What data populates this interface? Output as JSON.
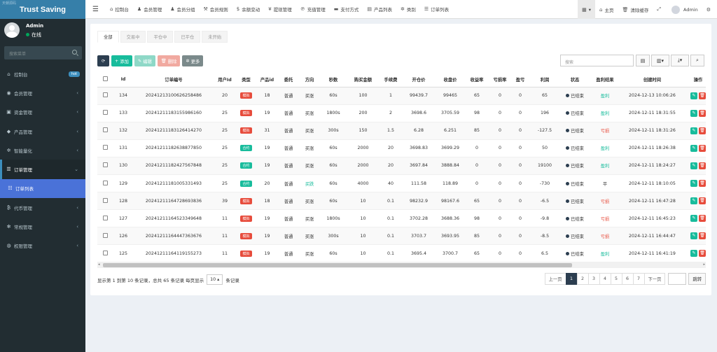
{
  "app": {
    "title": "Trust Saving",
    "watermark": "天朝源码"
  },
  "user": {
    "name": "Admin",
    "status": "在线"
  },
  "sidebar": {
    "search_placeholder": "搜索菜单",
    "items": [
      {
        "icon": "dashboard-icon",
        "glyph": "⌂",
        "label": "控制台",
        "badge": "hot"
      },
      {
        "icon": "user-icon",
        "glyph": "◉",
        "label": "会员管理",
        "arrow": "‹"
      },
      {
        "icon": "money-icon",
        "glyph": "▣",
        "label": "资金管理",
        "arrow": "‹"
      },
      {
        "icon": "product-icon",
        "glyph": "◆",
        "label": "产品管理",
        "arrow": "‹"
      },
      {
        "icon": "gear-icon",
        "glyph": "✲",
        "label": "智能量化",
        "arrow": "‹"
      },
      {
        "icon": "list-icon",
        "glyph": "☰",
        "label": "订单管理",
        "arrow": "⌄"
      },
      {
        "icon": "list-icon",
        "glyph": "☷",
        "label": "订单列表"
      },
      {
        "icon": "bitcoin-icon",
        "glyph": "₿",
        "label": "代币管理",
        "arrow": "‹"
      },
      {
        "icon": "cogs-icon",
        "glyph": "✻",
        "label": "常规管理",
        "arrow": "‹"
      },
      {
        "icon": "users-icon",
        "glyph": "◍",
        "label": "权限管理",
        "arrow": "‹"
      }
    ]
  },
  "topnav": {
    "items": [
      {
        "icon": "dashboard-icon",
        "glyph": "⌂",
        "label": "控制台"
      },
      {
        "icon": "user-icon",
        "glyph": "♟",
        "label": "会员管理"
      },
      {
        "icon": "users-icon",
        "glyph": "♟",
        "label": "会员分组"
      },
      {
        "icon": "gavel-icon",
        "glyph": "⚒",
        "label": "会员规则"
      },
      {
        "icon": "dollar-icon",
        "glyph": "$",
        "label": "余额变动"
      },
      {
        "icon": "yen-icon",
        "glyph": "¥",
        "label": "提现管理"
      },
      {
        "icon": "paypal-icon",
        "glyph": "℗",
        "label": "充值管理"
      },
      {
        "icon": "card-icon",
        "glyph": "▬",
        "label": "支付方式"
      },
      {
        "icon": "folder-icon",
        "glyph": "▤",
        "label": "产品列表"
      },
      {
        "icon": "gear-icon",
        "glyph": "✲",
        "label": "类别"
      },
      {
        "icon": "list-icon",
        "glyph": "☰",
        "label": "订单列表"
      }
    ],
    "right": {
      "home": "主页",
      "clear_cache": "清除缓存",
      "admin": "Admin"
    }
  },
  "tabs": [
    "全部",
    "交易中",
    "平仓中",
    "已平仓",
    "未开始"
  ],
  "toolbar": {
    "add": "添加",
    "edit": "编辑",
    "delete": "删除",
    "more": "更多"
  },
  "search": {
    "placeholder": "搜索"
  },
  "table": {
    "columns": [
      "Id",
      "订单编号",
      "用户Id",
      "类型",
      "产品id",
      "委托",
      "方向",
      "秒数",
      "购买金额",
      "手续费",
      "开仓价",
      "收盘价",
      "收益率",
      "亏损率",
      "盈亏",
      "利润",
      "状态",
      "盈利结果",
      "创建时间",
      "操作"
    ],
    "rows": [
      {
        "id": "134",
        "order_no": "20241213100626258486",
        "user_id": "20",
        "type": "模拟",
        "type_color": "red",
        "product_id": "18",
        "entrust": "普通",
        "direction": "买涨",
        "seconds": "60s",
        "amount": "100",
        "fee": "1",
        "open": "99439.7",
        "close": "99465",
        "rate": "65",
        "loss_rate": "0",
        "pnl": "0",
        "profit": "65",
        "status": "已结束",
        "result": "盈利",
        "result_color": "#18bc9c",
        "created": "2024-12-13 10:06:26"
      },
      {
        "id": "133",
        "order_no": "20241211183155986160",
        "user_id": "25",
        "type": "模拟",
        "type_color": "red",
        "product_id": "19",
        "entrust": "普通",
        "direction": "买涨",
        "seconds": "1800s",
        "amount": "200",
        "fee": "2",
        "open": "3698.6",
        "close": "3705.59",
        "rate": "98",
        "loss_rate": "0",
        "pnl": "0",
        "profit": "196",
        "status": "已结束",
        "result": "盈利",
        "result_color": "#18bc9c",
        "created": "2024-12-11 18:31:55"
      },
      {
        "id": "132",
        "order_no": "20241211183126414270",
        "user_id": "25",
        "type": "模拟",
        "type_color": "red",
        "product_id": "31",
        "entrust": "普通",
        "direction": "买涨",
        "seconds": "300s",
        "amount": "150",
        "fee": "1.5",
        "open": "6.28",
        "close": "6.251",
        "rate": "85",
        "loss_rate": "0",
        "pnl": "0",
        "profit": "-127.5",
        "status": "已结束",
        "result": "亏损",
        "result_color": "#e74c3c",
        "created": "2024-12-11 18:31:26"
      },
      {
        "id": "131",
        "order_no": "20241211182638877850",
        "user_id": "25",
        "type": "合约",
        "type_color": "grn",
        "product_id": "19",
        "entrust": "普通",
        "direction": "买涨",
        "seconds": "60s",
        "amount": "2000",
        "fee": "20",
        "open": "3698.83",
        "close": "3699.29",
        "rate": "0",
        "loss_rate": "0",
        "pnl": "0",
        "profit": "50",
        "status": "已结束",
        "result": "盈利",
        "result_color": "#18bc9c",
        "created": "2024-12-11 18:26:38"
      },
      {
        "id": "130",
        "order_no": "20241211182427567848",
        "user_id": "25",
        "type": "合约",
        "type_color": "grn",
        "product_id": "19",
        "entrust": "普通",
        "direction": "买涨",
        "seconds": "60s",
        "amount": "2000",
        "fee": "20",
        "open": "3697.84",
        "close": "3888.84",
        "rate": "0",
        "loss_rate": "0",
        "pnl": "0",
        "profit": "19100",
        "status": "已结束",
        "result": "盈利",
        "result_color": "#18bc9c",
        "created": "2024-12-11 18:24:27"
      },
      {
        "id": "129",
        "order_no": "20241211181005331493",
        "user_id": "25",
        "type": "合约",
        "type_color": "grn",
        "product_id": "20",
        "entrust": "普通",
        "direction": "买跌",
        "dir_color": "#18bc9c",
        "seconds": "60s",
        "amount": "4000",
        "fee": "40",
        "open": "111.58",
        "close": "118.89",
        "rate": "0",
        "loss_rate": "0",
        "pnl": "0",
        "profit": "-730",
        "status": "已结束",
        "result": "平",
        "result_color": "#333333",
        "created": "2024-12-11 18:10:05"
      },
      {
        "id": "128",
        "order_no": "20241211164728693836",
        "user_id": "39",
        "type": "模拟",
        "type_color": "red",
        "product_id": "18",
        "entrust": "普通",
        "direction": "买涨",
        "seconds": "60s",
        "amount": "10",
        "fee": "0.1",
        "open": "98232.9",
        "close": "98167.6",
        "rate": "65",
        "loss_rate": "0",
        "pnl": "0",
        "profit": "-6.5",
        "status": "已结束",
        "result": "亏损",
        "result_color": "#e74c3c",
        "created": "2024-12-11 16:47:28"
      },
      {
        "id": "127",
        "order_no": "20241211164523349648",
        "user_id": "11",
        "type": "模拟",
        "type_color": "red",
        "product_id": "19",
        "entrust": "普通",
        "direction": "买涨",
        "seconds": "1800s",
        "amount": "10",
        "fee": "0.1",
        "open": "3702.28",
        "close": "3688.36",
        "rate": "98",
        "loss_rate": "0",
        "pnl": "0",
        "profit": "-9.8",
        "status": "已结束",
        "result": "亏损",
        "result_color": "#e74c3c",
        "created": "2024-12-11 16:45:23"
      },
      {
        "id": "126",
        "order_no": "20241211164447363676",
        "user_id": "11",
        "type": "模拟",
        "type_color": "red",
        "product_id": "19",
        "entrust": "普通",
        "direction": "买涨",
        "seconds": "300s",
        "amount": "10",
        "fee": "0.1",
        "open": "3703.7",
        "close": "3693.95",
        "rate": "85",
        "loss_rate": "0",
        "pnl": "0",
        "profit": "-8.5",
        "status": "已结束",
        "result": "亏损",
        "result_color": "#e74c3c",
        "created": "2024-12-11 16:44:47"
      },
      {
        "id": "125",
        "order_no": "20241211164119155273",
        "user_id": "11",
        "type": "模拟",
        "type_color": "red",
        "product_id": "19",
        "entrust": "普通",
        "direction": "买涨",
        "seconds": "60s",
        "amount": "10",
        "fee": "0.1",
        "open": "3695.4",
        "close": "3700.7",
        "rate": "65",
        "loss_rate": "0",
        "pnl": "0",
        "profit": "6.5",
        "status": "已结束",
        "result": "盈利",
        "result_color": "#18bc9c",
        "created": "2024-12-11 16:41:19"
      }
    ]
  },
  "footer": {
    "showing": "显示第 1 到第 10 条记录，总共 65 条记录 每页显示",
    "page_size": "10",
    "records_suffix": "条记录"
  },
  "pagination": {
    "prev": "上一页",
    "pages": [
      "1",
      "2",
      "3",
      "4",
      "5",
      "6",
      "7"
    ],
    "current": "1",
    "next": "下一页",
    "jump": "跳转"
  }
}
